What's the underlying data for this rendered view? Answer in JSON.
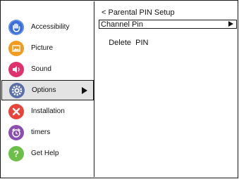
{
  "menu": {
    "items": [
      {
        "label": "Accessibility",
        "icon": "accessibility-hand-icon",
        "color": "#3a6fd8"
      },
      {
        "label": "Picture",
        "icon": "picture-icon",
        "color": "#f29c1f"
      },
      {
        "label": "Sound",
        "icon": "speaker-icon",
        "color": "#e0306e"
      },
      {
        "label": "Options",
        "icon": "gear-icon",
        "color": "#5b6fa8",
        "selected": true
      },
      {
        "label": "Installation",
        "icon": "tools-icon",
        "color": "#e8443c"
      },
      {
        "label": "timers",
        "icon": "alarm-clock-icon",
        "color": "#8a4fb0"
      },
      {
        "label": "Get Help",
        "icon": "help-icon",
        "color": "#6cc04a"
      }
    ]
  },
  "panel": {
    "title": "< Parental PIN Setup",
    "options": [
      {
        "label": "Channel Pin",
        "selected": true
      },
      {
        "label": "Delete  PIN"
      }
    ]
  }
}
